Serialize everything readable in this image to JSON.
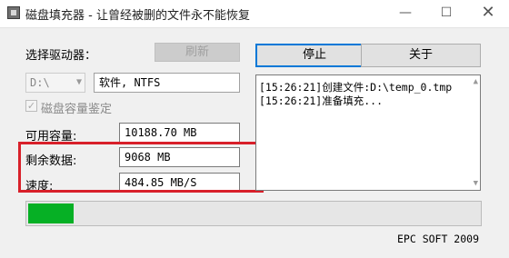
{
  "window": {
    "title": "磁盘填充器 - 让曾经被删的文件永不能恢复",
    "minimize": "—",
    "maximize": "☐",
    "close": "✕"
  },
  "drive": {
    "label": "选择驱动器：",
    "refresh_label": "刷新",
    "selected": "D:\\",
    "info": "软件, NTFS",
    "checkbox_label": "磁盘容量鉴定",
    "checkbox_checked": true
  },
  "stats": {
    "available_label": "可用容量:",
    "available_value": "10188.70 MB",
    "remaining_label": "剩余数据:",
    "remaining_value": "9068 MB",
    "speed_label": "速度:",
    "speed_value": "484.85 MB/S"
  },
  "buttons": {
    "stop_label": "停止",
    "about_label": "关于"
  },
  "log": {
    "lines": [
      "[15:26:21]创建文件:D:\\temp_0.tmp",
      "[15:26:21]准备填充..."
    ]
  },
  "progress": {
    "fraction": 0.1
  },
  "footer": {
    "copyright": "EPC SOFT 2009"
  },
  "colors": {
    "progress_fill": "#06b025",
    "highlight_border": "#d8202a",
    "default_button_border": "#0078d7"
  }
}
